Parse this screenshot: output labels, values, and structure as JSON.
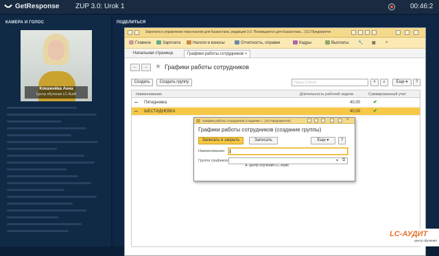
{
  "topbar": {
    "brand": "GetResponse",
    "title": "ZUP 3.0: Urok 1",
    "timer": "00:46:2"
  },
  "camera": {
    "panel_title": "КАМЕРА И ГОЛОС",
    "name": "Кокшенёва Анна",
    "org": "Центр обучения LC-Audit"
  },
  "share": {
    "panel_title": "ПОДЕЛИТЬСЯ"
  },
  "app": {
    "window_title": "Зарплата и управление персоналом для Казахстана, редакция 3.0. Посвящается для Казахстана... (1С:Предприятие)",
    "menu": [
      "Главное",
      "Зарплата",
      "Налоги и взносы",
      "Отчетность, справки",
      "Кадры",
      "Выплаты"
    ],
    "tabs": [
      "Начальная страница",
      "Графики работы сотрудников"
    ],
    "doc_title": "Графики работы сотрудников",
    "create_label": "Создать",
    "create_group_label": "Создать группу",
    "search_placeholder": "Поиск (Ctrl+F)",
    "more_label": "Еще",
    "help_label": "?",
    "columns": [
      "Наименование",
      "Длительность рабочей недели",
      "Суммированный учет"
    ],
    "rows": [
      {
        "name": "Пятидневка",
        "duration": "40,00",
        "summed": "✔"
      },
      {
        "name": "ШЕСТИДНЕВКА",
        "duration": "40,00",
        "summed": "✔"
      }
    ]
  },
  "dialog": {
    "window_title": "Графики работы сотрудников (создание г... (1С:Предприятие)",
    "title": "Графики работы сотрудников (создание группы)",
    "save_close_label": "Записать и закрыть",
    "save_label": "Записать",
    "more_label": "Еще",
    "help_label": "?",
    "name_label": "Наименование:",
    "name_value": "",
    "group_label": "Группа графиков:",
    "group_value": ""
  },
  "cursor_tooltip": "Центр обучения LC-Audit",
  "brand_logo": {
    "name": "LC-АУДИТ",
    "sub": "центр обучения"
  },
  "colors": {
    "accent": "#f6c845",
    "titlebar": "#f5d98a",
    "page_bg": "#0b1f36"
  }
}
